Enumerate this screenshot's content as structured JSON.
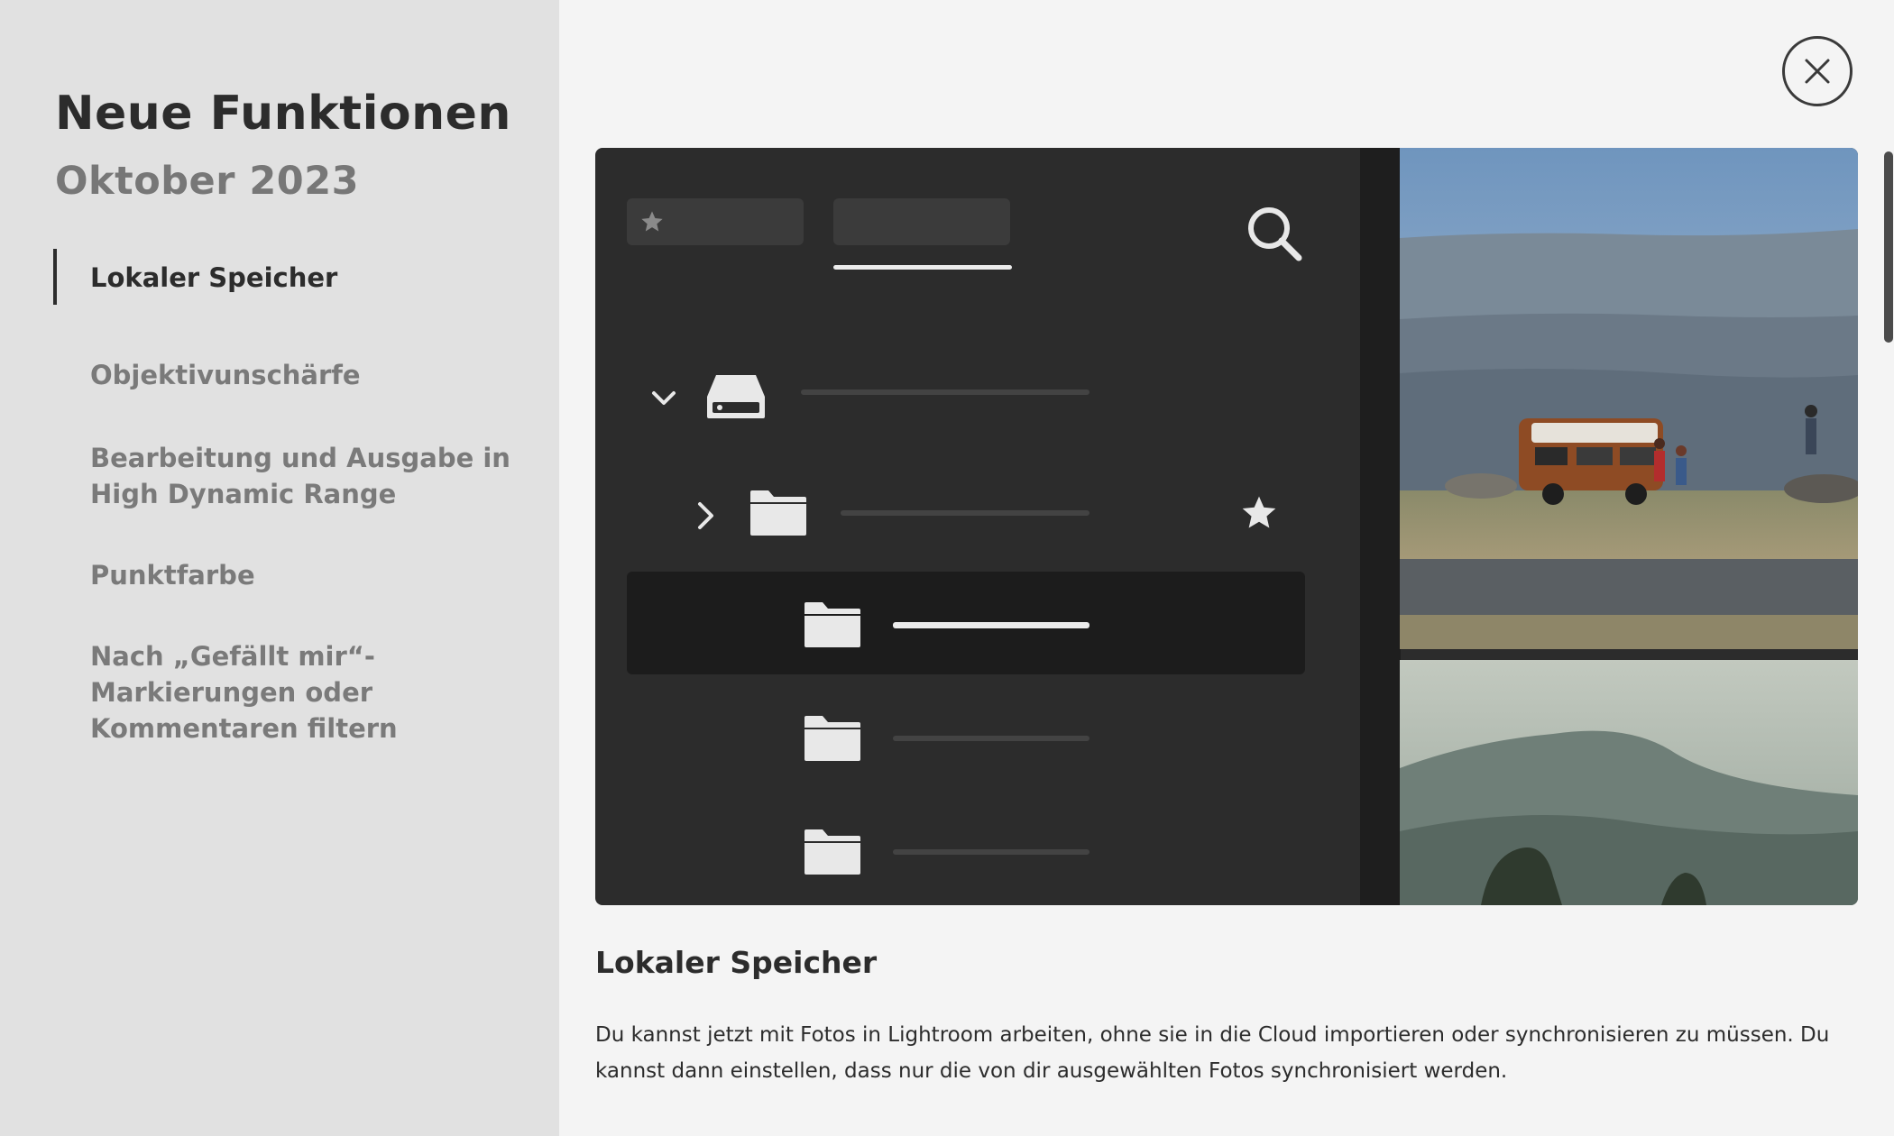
{
  "sidebar": {
    "title": "Neue Funktionen",
    "subtitle": "Oktober 2023",
    "items": [
      {
        "label": "Lokaler Speicher",
        "active": true
      },
      {
        "label": "Objektivunschärfe",
        "active": false
      },
      {
        "label": "Bearbeitung und Ausgabe in High Dynamic Range",
        "active": false
      },
      {
        "label": "Punktfarbe",
        "active": false
      },
      {
        "label": "Nach „Gefällt mir“-Markierungen oder Kommentaren filtern",
        "active": false
      }
    ]
  },
  "article": {
    "title": "Lokaler Speicher",
    "body": "Du kannst jetzt mit Fotos in Lightroom arbeiten, ohne sie in die Cloud importieren oder synchronisieren zu müssen. Du kannst dann einstellen, dass nur die von dir ausgewählten Fotos synchronisiert werden."
  },
  "icons": {
    "close": "close-icon",
    "search": "search-icon",
    "star": "star-icon",
    "drive": "hard-drive-icon",
    "folder": "folder-icon",
    "chevron_down": "chevron-down-icon",
    "chevron_right": "chevron-right-icon"
  },
  "colors": {
    "sidebar_bg": "#e1e1e1",
    "page_bg": "#f4f4f4",
    "panel_bg": "#2c2c2c",
    "text_primary": "#2c2c2c",
    "text_muted": "#7a7a7a"
  }
}
